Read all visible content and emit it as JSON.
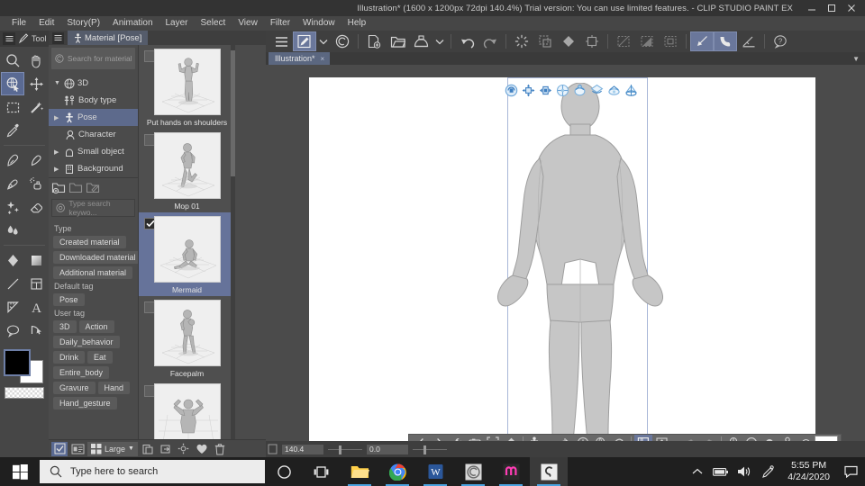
{
  "window": {
    "title": "Illustration* (1600 x 1200px 72dpi 140.4%)  Trial version: You can use limited features. - CLIP STUDIO PAINT EX",
    "minimize": "–",
    "maximize": "☐",
    "close": "✕"
  },
  "menubar": {
    "items": [
      "File",
      "Edit",
      "Story(P)",
      "Animation",
      "Layer",
      "Select",
      "View",
      "Filter",
      "Window",
      "Help"
    ]
  },
  "tool_palette": {
    "header_label": "Tool",
    "tools": [
      {
        "name": "zoom-tool",
        "glyph": "magnifier"
      },
      {
        "name": "hand-tool",
        "glyph": "hand"
      },
      {
        "name": "operation-tool",
        "glyph": "object-select",
        "selected": true
      },
      {
        "name": "move-layer-tool",
        "glyph": "move"
      },
      {
        "name": "selection-tool",
        "glyph": "marquee"
      },
      {
        "name": "auto-select-tool",
        "glyph": "magic-wand"
      },
      {
        "name": "eyedropper-tool",
        "glyph": "eyedropper"
      },
      {
        "name": "pen-tool",
        "glyph": "pen"
      },
      {
        "name": "pencil-tool",
        "glyph": "pencil"
      },
      {
        "name": "brush-tool",
        "glyph": "brush"
      },
      {
        "name": "airbrush-tool",
        "glyph": "airbrush"
      },
      {
        "name": "decoration-tool",
        "glyph": "sparkle"
      },
      {
        "name": "eraser-tool",
        "glyph": "eraser"
      },
      {
        "name": "blend-tool",
        "glyph": "blend"
      },
      {
        "name": "fill-tool",
        "glyph": "fill"
      },
      {
        "name": "gradient-tool",
        "glyph": "gradient"
      },
      {
        "name": "figure-tool",
        "glyph": "line"
      },
      {
        "name": "frame-border-tool",
        "glyph": "frame"
      },
      {
        "name": "ruler-tool",
        "glyph": "ruler"
      },
      {
        "name": "text-tool",
        "glyph": "text-A"
      },
      {
        "name": "balloon-tool",
        "glyph": "balloon"
      },
      {
        "name": "correct-line-tool",
        "glyph": "correct-line"
      }
    ],
    "colors": {
      "foreground": "#000000",
      "background": "#ffffff",
      "transparent_label": "transparent"
    }
  },
  "material_panel": {
    "tab_label": "Material [Pose]",
    "asset_search_label": "Search for materials on AS",
    "tree": [
      {
        "label": "3D",
        "level": 0,
        "expanded": true,
        "icon": "cube-icon",
        "selected": false
      },
      {
        "label": "Body type",
        "level": 1,
        "expanded": false,
        "icon": "body-icon",
        "selected": false
      },
      {
        "label": "Pose",
        "level": 1,
        "expanded": false,
        "icon": "pose-icon",
        "selected": true
      },
      {
        "label": "Character",
        "level": 1,
        "expanded": false,
        "icon": "character-icon",
        "selected": false
      },
      {
        "label": "Small object",
        "level": 1,
        "expanded": false,
        "icon": "small-object-icon",
        "selected": false
      },
      {
        "label": "Background",
        "level": 1,
        "expanded": false,
        "icon": "background-icon",
        "selected": false
      }
    ],
    "search_placeholder": "Type search keywo...",
    "filters": [
      {
        "heading": "Type",
        "tags": [
          "Created material",
          "Downloaded material",
          "Additional material"
        ]
      },
      {
        "heading": "Default tag",
        "tags": [
          "Pose"
        ]
      },
      {
        "heading": "User tag",
        "tags": [
          "3D",
          "Action",
          "Daily_behavior",
          "Drink",
          "Eat",
          "Entire_body",
          "Gravure",
          "Hand",
          "Hand_gesture"
        ]
      }
    ],
    "footer": {
      "view_size_label": "Large"
    },
    "materials": [
      {
        "name": "Put hands on shoulders",
        "selected": false,
        "pose": "standing-hands-up"
      },
      {
        "name": "Mop 01",
        "selected": false,
        "pose": "mopping"
      },
      {
        "name": "Mermaid",
        "selected": true,
        "pose": "kneeling"
      },
      {
        "name": "Facepalm",
        "selected": false,
        "pose": "facepalm"
      },
      {
        "name": "",
        "selected": false,
        "pose": "arms-behind-head"
      }
    ]
  },
  "command_bar": {
    "buttons": [
      {
        "name": "menu-hamburger-icon",
        "glyph": "hamburger"
      },
      {
        "name": "brush-size-icon",
        "glyph": "brush-box",
        "selected": true
      },
      {
        "name": "chevron-down-icon",
        "glyph": "chevron"
      },
      {
        "name": "clip-studio-icon",
        "glyph": "spiral"
      },
      {
        "name": "new-file-icon",
        "glyph": "new-doc"
      },
      {
        "name": "open-file-icon",
        "glyph": "folder"
      },
      {
        "name": "save-icon",
        "glyph": "save"
      },
      {
        "name": "save-chevron-icon",
        "glyph": "chevron"
      },
      {
        "name": "undo-icon",
        "glyph": "undo"
      },
      {
        "name": "redo-icon",
        "glyph": "redo"
      },
      {
        "name": "clear-icon",
        "glyph": "dotted-circle"
      },
      {
        "name": "fill-selection-icon",
        "glyph": "fill-sel"
      },
      {
        "name": "scale-rotate-icon",
        "glyph": "scale-rot"
      },
      {
        "name": "selection-fill-icon",
        "glyph": "sel-fill"
      },
      {
        "name": "crop-icon",
        "glyph": "crop"
      },
      {
        "name": "deselect-icon",
        "glyph": "deselect"
      },
      {
        "name": "invert-selection-icon",
        "glyph": "invert-sel"
      },
      {
        "name": "expand-selection-icon",
        "glyph": "expand-sel"
      },
      {
        "name": "perspective-ruler-icon",
        "glyph": "persp-ruler",
        "selected": true
      },
      {
        "name": "curve-ruler-icon",
        "glyph": "curve-ruler",
        "selected": true
      },
      {
        "name": "ruler-snap-icon",
        "glyph": "ruler-snap"
      },
      {
        "name": "help-icon",
        "glyph": "help"
      }
    ]
  },
  "document_tab": {
    "label": "Illustration*",
    "close_glyph": "×"
  },
  "canvas": {
    "zoom_value": "140.4",
    "rotation_value": "0.0",
    "model_description": "3D drawing figure front view standing pose",
    "manipulator_icons": [
      "camera-rotate-icon",
      "camera-pan-icon",
      "camera-move-icon",
      "object-move-icon",
      "object-rotate-icon",
      "object-rotate-y-icon",
      "object-rotate-z-icon",
      "object-scale-icon"
    ]
  },
  "object_toolbar_3d": {
    "buttons": [
      {
        "name": "previous-material-icon",
        "glyph": "prev"
      },
      {
        "name": "next-material-icon",
        "glyph": "next"
      },
      {
        "name": "object-settings-icon",
        "glyph": "wrench"
      },
      {
        "name": "camera-register-icon",
        "glyph": "camera"
      },
      {
        "name": "fit-to-canvas-icon",
        "glyph": "fit"
      },
      {
        "name": "reset-camera-icon",
        "glyph": "reset-cam"
      },
      {
        "name": "pose-register-icon",
        "glyph": "pose-add"
      },
      {
        "name": "pose-dropdown-icon",
        "glyph": "chevron"
      },
      {
        "name": "flip-pose-icon",
        "glyph": "flip"
      },
      {
        "name": "reset-pose-icon",
        "glyph": "reset-pose"
      },
      {
        "name": "reset-body-icon",
        "glyph": "reset-body"
      },
      {
        "name": "reset-rotation-icon",
        "glyph": "reset-rot"
      },
      {
        "name": "layout-toggle-icon",
        "glyph": "layout",
        "selected": true
      },
      {
        "name": "body-shape-icon",
        "glyph": "body-shape"
      },
      {
        "name": "body-shape-dropdown-icon",
        "glyph": "chevron"
      },
      {
        "name": "hand-setup-icon",
        "glyph": "hand-left"
      },
      {
        "name": "hand-setup-right-icon",
        "glyph": "hand-right"
      },
      {
        "name": "head-icon",
        "glyph": "head"
      },
      {
        "name": "face-icon",
        "glyph": "face"
      },
      {
        "name": "hair-icon",
        "glyph": "hair"
      },
      {
        "name": "upper-body-icon",
        "glyph": "upper-body"
      },
      {
        "name": "bag-icon",
        "glyph": "bag"
      },
      {
        "name": "color-swatch",
        "glyph": "white-box"
      }
    ]
  },
  "taskbar": {
    "search_placeholder": "Type here to search",
    "apps": [
      {
        "name": "cortana-icon",
        "glyph": "circle"
      },
      {
        "name": "task-view-icon",
        "glyph": "taskview"
      },
      {
        "name": "file-explorer-icon",
        "glyph": "folder"
      },
      {
        "name": "chrome-icon",
        "glyph": "chrome"
      },
      {
        "name": "word-icon",
        "glyph": "word"
      },
      {
        "name": "clip-studio-icon",
        "glyph": "spiral-gray"
      },
      {
        "name": "clip-studio-pink-icon",
        "glyph": "spiral-pink"
      },
      {
        "name": "clip-studio-paint-icon",
        "glyph": "csp",
        "active": true
      }
    ],
    "tray": [
      {
        "name": "show-hidden-icons",
        "glyph": "chevron-up"
      },
      {
        "name": "battery-icon",
        "glyph": "battery"
      },
      {
        "name": "volume-icon",
        "glyph": "speaker"
      },
      {
        "name": "pen-tablet-icon",
        "glyph": "tablet"
      }
    ],
    "clock": {
      "time": "5:55 PM",
      "date": "4/24/2020"
    },
    "action_center": "notification-icon"
  }
}
